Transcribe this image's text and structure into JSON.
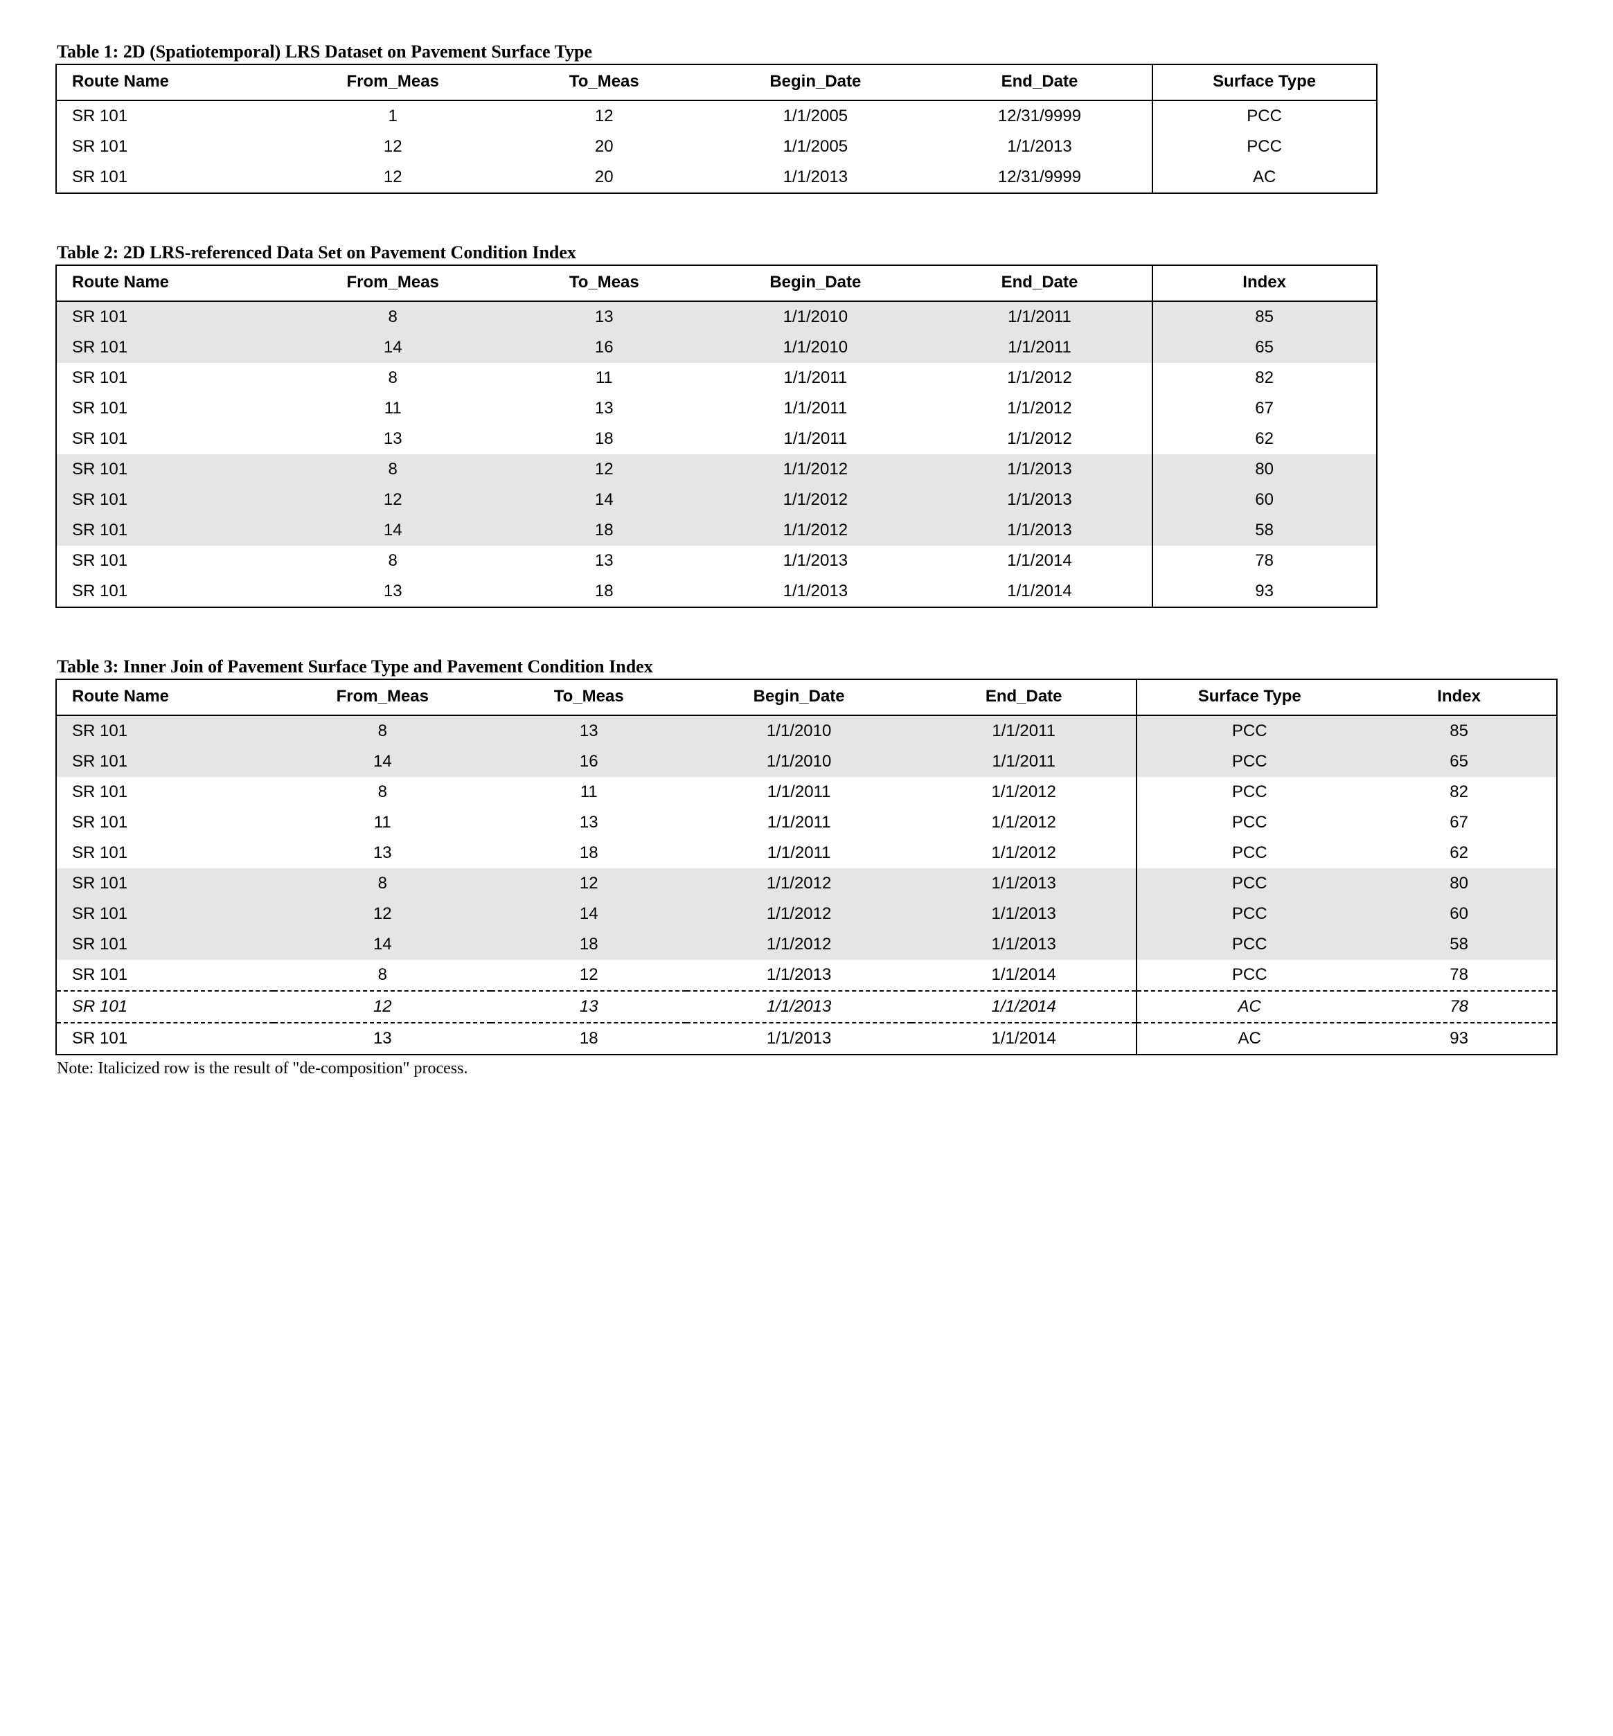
{
  "table1": {
    "caption": "Table 1:  2D (Spatiotemporal) LRS Dataset on Pavement Surface Type",
    "headers": {
      "route": "Route Name",
      "from": "From_Meas",
      "to": "To_Meas",
      "begin": "Begin_Date",
      "end": "End_Date",
      "surface": "Surface Type"
    },
    "rows": [
      {
        "route": "SR 101",
        "from": "1",
        "to": "12",
        "begin": "1/1/2005",
        "end": "12/31/9999",
        "surface": "PCC"
      },
      {
        "route": "SR 101",
        "from": "12",
        "to": "20",
        "begin": "1/1/2005",
        "end": "1/1/2013",
        "surface": "PCC"
      },
      {
        "route": "SR 101",
        "from": "12",
        "to": "20",
        "begin": "1/1/2013",
        "end": "12/31/9999",
        "surface": "AC"
      }
    ]
  },
  "table2": {
    "caption": "Table 2:  2D LRS-referenced Data Set on Pavement Condition Index",
    "headers": {
      "route": "Route Name",
      "from": "From_Meas",
      "to": "To_Meas",
      "begin": "Begin_Date",
      "end": "End_Date",
      "index": "Index"
    },
    "rows": [
      {
        "route": "SR 101",
        "from": "8",
        "to": "13",
        "begin": "1/1/2010",
        "end": "1/1/2011",
        "index": "85",
        "shaded": true
      },
      {
        "route": "SR 101",
        "from": "14",
        "to": "16",
        "begin": "1/1/2010",
        "end": "1/1/2011",
        "index": "65",
        "shaded": true
      },
      {
        "route": "SR 101",
        "from": "8",
        "to": "11",
        "begin": "1/1/2011",
        "end": "1/1/2012",
        "index": "82",
        "shaded": false
      },
      {
        "route": "SR 101",
        "from": "11",
        "to": "13",
        "begin": "1/1/2011",
        "end": "1/1/2012",
        "index": "67",
        "shaded": false
      },
      {
        "route": "SR 101",
        "from": "13",
        "to": "18",
        "begin": "1/1/2011",
        "end": "1/1/2012",
        "index": "62",
        "shaded": false
      },
      {
        "route": "SR 101",
        "from": "8",
        "to": "12",
        "begin": "1/1/2012",
        "end": "1/1/2013",
        "index": "80",
        "shaded": true
      },
      {
        "route": "SR 101",
        "from": "12",
        "to": "14",
        "begin": "1/1/2012",
        "end": "1/1/2013",
        "index": "60",
        "shaded": true
      },
      {
        "route": "SR 101",
        "from": "14",
        "to": "18",
        "begin": "1/1/2012",
        "end": "1/1/2013",
        "index": "58",
        "shaded": true
      },
      {
        "route": "SR 101",
        "from": "8",
        "to": "13",
        "begin": "1/1/2013",
        "end": "1/1/2014",
        "index": "78",
        "shaded": false
      },
      {
        "route": "SR 101",
        "from": "13",
        "to": "18",
        "begin": "1/1/2013",
        "end": "1/1/2014",
        "index": "93",
        "shaded": false
      }
    ]
  },
  "table3": {
    "caption": "Table 3:  Inner Join of Pavement Surface Type and Pavement Condition Index",
    "headers": {
      "route": "Route Name",
      "from": "From_Meas",
      "to": "To_Meas",
      "begin": "Begin_Date",
      "end": "End_Date",
      "surface": "Surface Type",
      "index": "Index"
    },
    "rows": [
      {
        "route": "SR 101",
        "from": "8",
        "to": "13",
        "begin": "1/1/2010",
        "end": "1/1/2011",
        "surface": "PCC",
        "index": "85",
        "shaded": true,
        "italic": false,
        "dashed": false
      },
      {
        "route": "SR 101",
        "from": "14",
        "to": "16",
        "begin": "1/1/2010",
        "end": "1/1/2011",
        "surface": "PCC",
        "index": "65",
        "shaded": true,
        "italic": false,
        "dashed": false
      },
      {
        "route": "SR 101",
        "from": "8",
        "to": "11",
        "begin": "1/1/2011",
        "end": "1/1/2012",
        "surface": "PCC",
        "index": "82",
        "shaded": false,
        "italic": false,
        "dashed": false
      },
      {
        "route": "SR 101",
        "from": "11",
        "to": "13",
        "begin": "1/1/2011",
        "end": "1/1/2012",
        "surface": "PCC",
        "index": "67",
        "shaded": false,
        "italic": false,
        "dashed": false
      },
      {
        "route": "SR 101",
        "from": "13",
        "to": "18",
        "begin": "1/1/2011",
        "end": "1/1/2012",
        "surface": "PCC",
        "index": "62",
        "shaded": false,
        "italic": false,
        "dashed": false
      },
      {
        "route": "SR 101",
        "from": "8",
        "to": "12",
        "begin": "1/1/2012",
        "end": "1/1/2013",
        "surface": "PCC",
        "index": "80",
        "shaded": true,
        "italic": false,
        "dashed": false
      },
      {
        "route": "SR 101",
        "from": "12",
        "to": "14",
        "begin": "1/1/2012",
        "end": "1/1/2013",
        "surface": "PCC",
        "index": "60",
        "shaded": true,
        "italic": false,
        "dashed": false
      },
      {
        "route": "SR 101",
        "from": "14",
        "to": "18",
        "begin": "1/1/2012",
        "end": "1/1/2013",
        "surface": "PCC",
        "index": "58",
        "shaded": true,
        "italic": false,
        "dashed": false
      },
      {
        "route": "SR 101",
        "from": "8",
        "to": "12",
        "begin": "1/1/2013",
        "end": "1/1/2014",
        "surface": "PCC",
        "index": "78",
        "shaded": false,
        "italic": false,
        "dashed": false
      },
      {
        "route": "SR 101",
        "from": "12",
        "to": "13",
        "begin": "1/1/2013",
        "end": "1/1/2014",
        "surface": "AC",
        "index": "78",
        "shaded": false,
        "italic": true,
        "dashed": true
      },
      {
        "route": "SR 101",
        "from": "13",
        "to": "18",
        "begin": "1/1/2013",
        "end": "1/1/2014",
        "surface": "AC",
        "index": "93",
        "shaded": false,
        "italic": false,
        "dashed": false
      }
    ]
  },
  "note": "Note:  Italicized row is the result of \"de-composition\" process."
}
